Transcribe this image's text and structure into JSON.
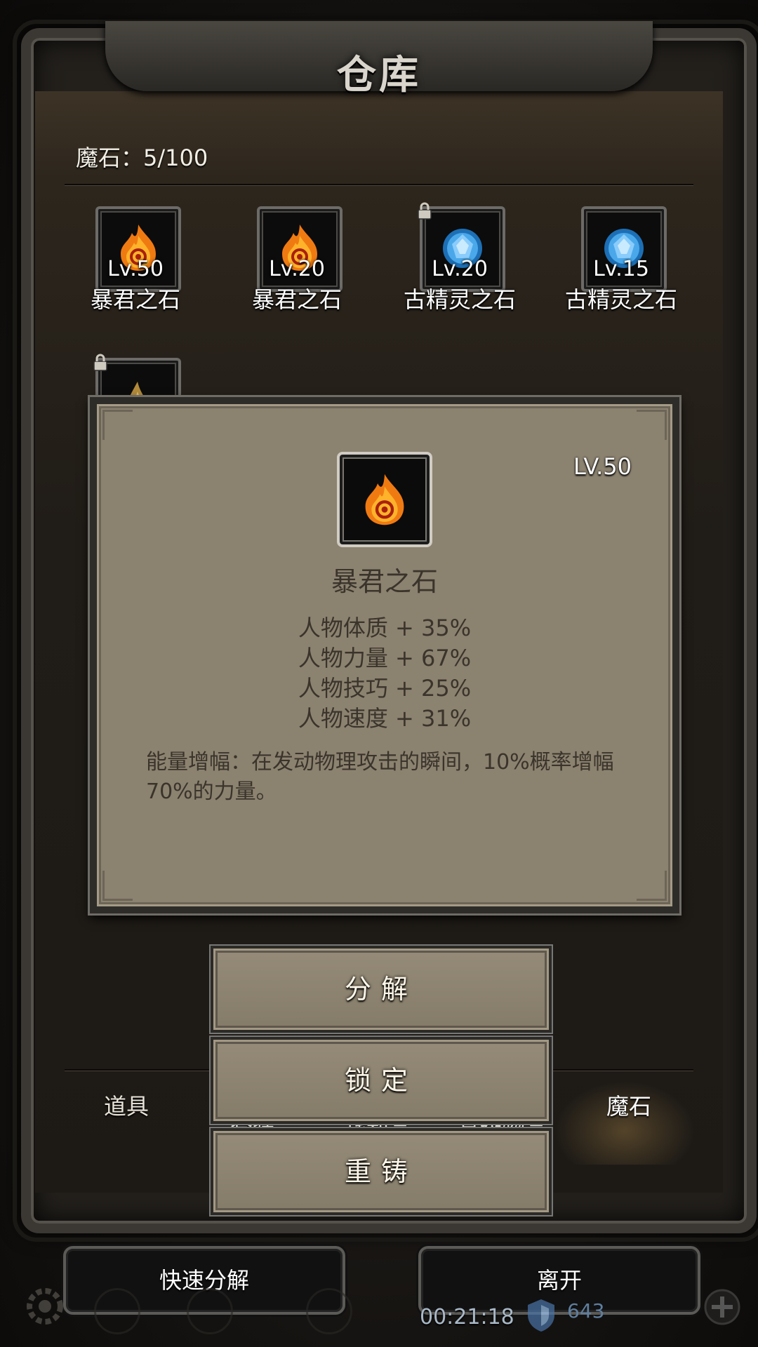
{
  "window": {
    "title": "仓库"
  },
  "inventory": {
    "count_label": "魔石：5/100"
  },
  "items": [
    {
      "level": "Lv.50",
      "name": "暴君之石",
      "gem": "fire-stone-icon",
      "locked": false
    },
    {
      "level": "Lv.20",
      "name": "暴君之石",
      "gem": "fire-stone-icon",
      "locked": false
    },
    {
      "level": "Lv.20",
      "name": "古精灵之石",
      "gem": "blue-crystal-icon",
      "locked": true
    },
    {
      "level": "Lv.15",
      "name": "古精灵之石",
      "gem": "blue-crystal-icon",
      "locked": false
    },
    {
      "level": "",
      "name": "",
      "gem": "golden-horn-icon",
      "locked": true
    }
  ],
  "detail": {
    "level": "LV.50",
    "name": "暴君之石",
    "stats": [
      "人物体质 + 35%",
      "人物力量 + 67%",
      "人物技巧 + 25%",
      "人物速度 + 31%"
    ],
    "description": "能量增幅：在发动物理攻击的瞬间，10%概率增幅70%的力量。"
  },
  "actions": {
    "decompose": "分解",
    "lock": "锁定",
    "reforge": "重铸"
  },
  "tabs": [
    {
      "label": "道具",
      "active": false
    },
    {
      "label": "套装",
      "active": false
    },
    {
      "label": "战利品",
      "active": false
    },
    {
      "label": "高级物品",
      "active": false
    },
    {
      "label": "魔石",
      "active": true
    }
  ],
  "bottom": {
    "quick_decompose": "快速分解",
    "leave": "离开",
    "timer": "00:21:18",
    "shield_count": "643"
  },
  "colors": {
    "panel_parchment": "#8c8270",
    "text_dark": "#3a342b",
    "frame_metal": "#3b3834"
  }
}
